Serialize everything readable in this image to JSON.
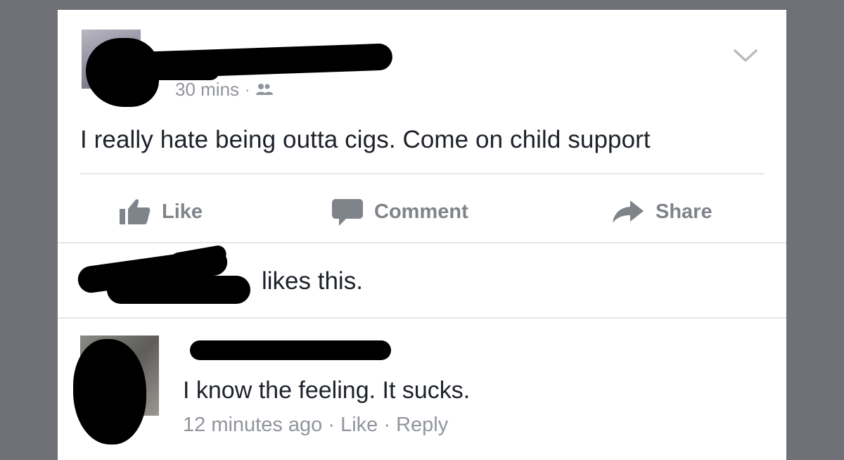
{
  "post": {
    "time": "30 mins",
    "separator": "·",
    "audience_icon": "friends-icon",
    "text": "I really hate being outta cigs. Come on child support",
    "menu_icon": "chevron-down-icon"
  },
  "actions": {
    "like_label": "Like",
    "comment_label": "Comment",
    "share_label": "Share"
  },
  "likes": {
    "text": "likes this."
  },
  "comment": {
    "text": "I know the feeling. It sucks.",
    "time": "12 minutes ago",
    "separator": "·",
    "like_label": "Like",
    "reply_label": "Reply"
  },
  "colors": {
    "background": "#6f7177",
    "card": "#ffffff",
    "text": "#1d2129",
    "muted": "#90949c",
    "action": "#7f838a",
    "redaction": "#000000"
  }
}
